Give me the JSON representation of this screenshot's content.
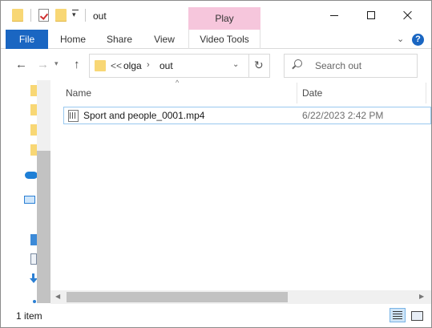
{
  "window": {
    "title": "out",
    "context_tab_group": "Play"
  },
  "ribbon": {
    "tabs": [
      "File",
      "Home",
      "Share",
      "View",
      "Video Tools"
    ],
    "chevron": "⌄",
    "help": "?"
  },
  "address_bar": {
    "overflow": "<<",
    "segments": [
      "olga",
      "out"
    ],
    "separator": "›"
  },
  "search": {
    "placeholder": "Search out"
  },
  "file_list": {
    "columns": [
      "Name",
      "Date"
    ],
    "rows": [
      {
        "name": "Sport and people_0001.mp4",
        "date": "6/22/2023 2:42 PM"
      }
    ]
  },
  "status_bar": {
    "item_count": "1 item"
  },
  "icons": {
    "quick_access": [
      "folder-icon",
      "properties-icon",
      "new-folder-icon",
      "customize-qat-icon"
    ],
    "nav": [
      "back-icon",
      "forward-icon",
      "recent-locations-icon",
      "up-icon",
      "refresh-icon",
      "search-icon"
    ],
    "nav_pane": [
      "folder-icon",
      "folder-icon",
      "folder-icon",
      "folder-icon",
      "onedrive-icon",
      "this-pc-icon",
      "desktop-icon",
      "documents-icon",
      "downloads-icon"
    ]
  },
  "colors": {
    "file_tab": "#1a66c2",
    "context_tab": "#f6c6dc",
    "selection_border": "#99c9ef"
  }
}
